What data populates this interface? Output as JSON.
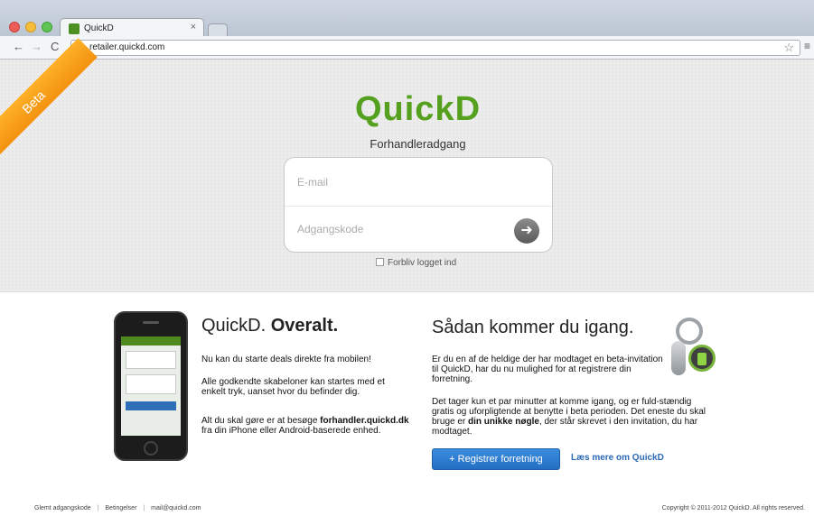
{
  "browser": {
    "tab_title": "QuickD",
    "tab_close": "×",
    "url": "retailer.quickd.com"
  },
  "badge": {
    "label": "Beta"
  },
  "login": {
    "logo": "QuickD",
    "subtitle": "Forhandleradgang",
    "email_placeholder": "E-mail",
    "password_placeholder": "Adgangskode",
    "remember_label": "Forbliv logget ind",
    "submit_arrow": "➜"
  },
  "left_section": {
    "heading_normal": "QuickD.",
    "heading_bold": "Overalt.",
    "p1": "Nu kan du starte deals direkte fra mobilen!",
    "p2": "Alle godkendte skabeloner kan startes med et enkelt tryk, uanset hvor du befinder dig.",
    "p3_a": "Alt du skal gøre er at besøge ",
    "p3_bold": "forhandler.quickd.dk",
    "p3_b": " fra din iPhone eller Android-baserede enhed."
  },
  "right_section": {
    "heading": "Sådan kommer du igang.",
    "p1": "Er du en af de heldige der har modtaget en beta-invitation til QuickD, har du nu mulighed for at registrere din forretning.",
    "p2_a": "Det tager kun et par minutter at komme igang, og er fuld-stændig gratis og uforpligtende at benytte i beta perioden. Det eneste du skal bruge er ",
    "p2_bold": "din unikke nøgle",
    "p2_b": ", der står skrevet i den invitation, du har modtaget.",
    "register_button": "+  Registrer forretning",
    "more_link": "Læs mere om QuickD"
  },
  "footer": {
    "link1": "Glemt adgangskode",
    "link2": "Betingelser",
    "link3": "mail@quickd.com",
    "separator": "|",
    "copyright": "Copyright © 2011-2012 QuickD. All rights reserved."
  },
  "colors": {
    "brand_green": "#55a01e",
    "beta_orange": "#f39210",
    "button_blue": "#236ec2"
  }
}
